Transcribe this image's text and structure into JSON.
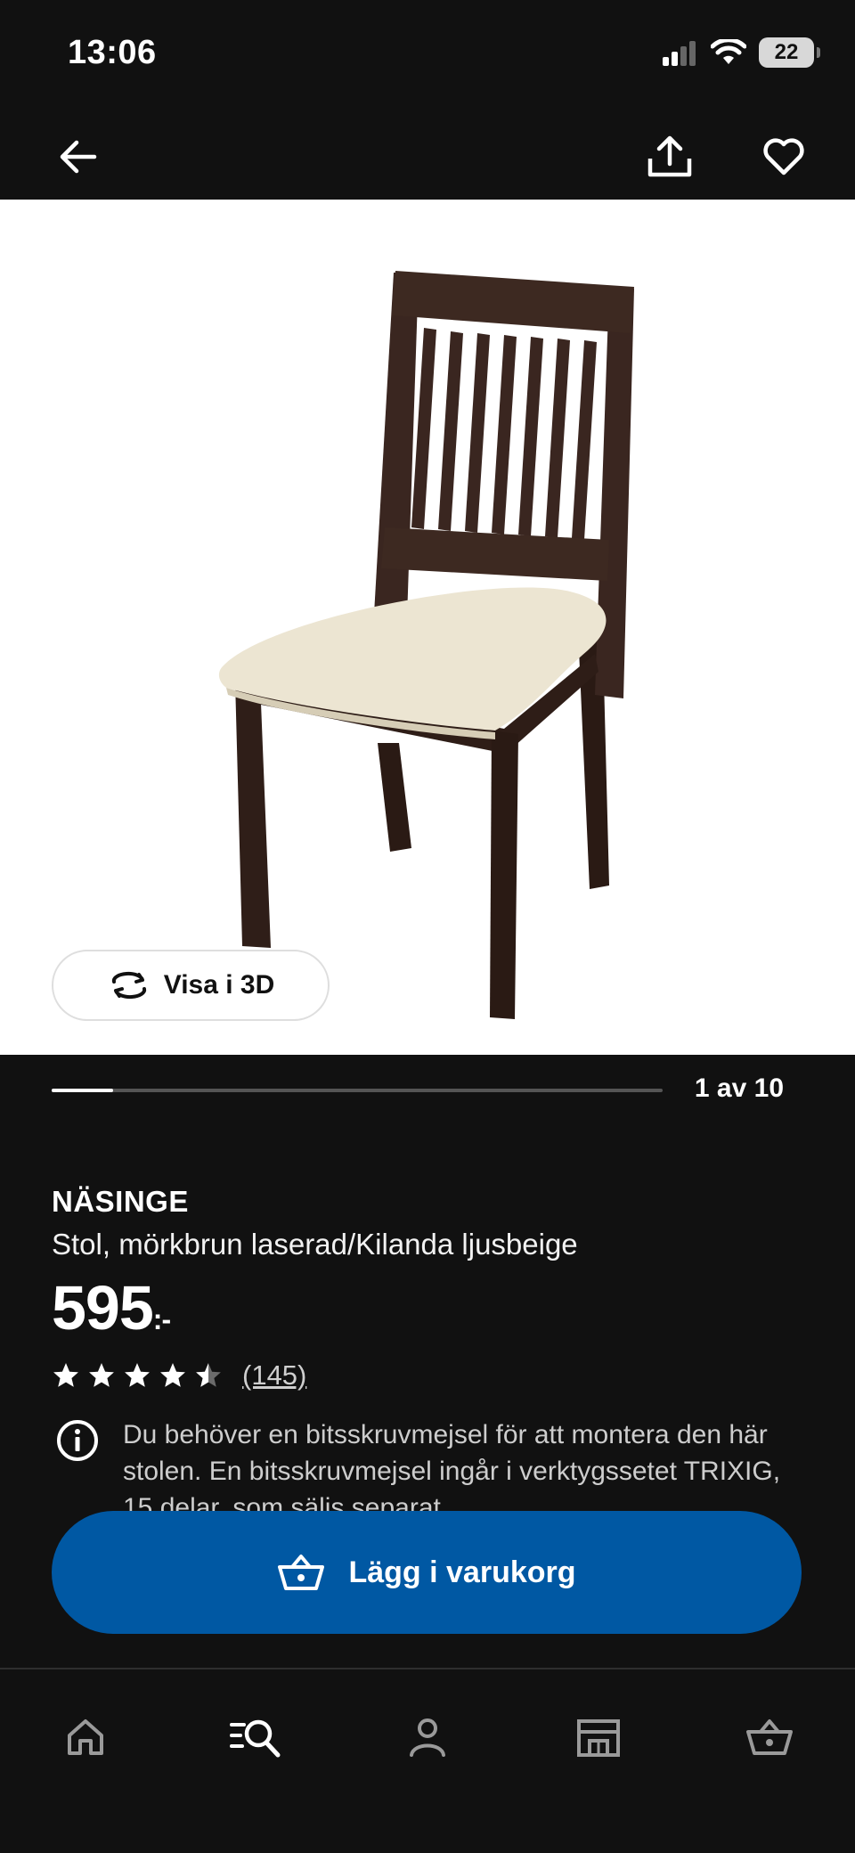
{
  "status_bar": {
    "time": "13:06",
    "battery": "22",
    "icons": [
      "cellular-signal-icon",
      "wifi-icon",
      "battery-icon"
    ]
  },
  "top_nav": {
    "icons": [
      "back-arrow-icon",
      "share-icon",
      "heart-icon"
    ]
  },
  "gallery": {
    "image_alt": "NÄSINGE chair",
    "view_3d_label": "Visa i 3D",
    "page_counter": "1 av 10",
    "progress_fraction": 0.1
  },
  "product": {
    "name": "NÄSINGE",
    "description": "Stol, mörkbrun laserad/Kilanda ljusbeige",
    "price": "595",
    "price_suffix": ":-",
    "rating": 4.5,
    "review_count": "(145)",
    "info_text": "Du behöver en bitsskruvmejsel för att montera den här stolen. En bitsskruvmejsel ingår i verktygssetet TRIXIG, 15 delar, som säljs separat."
  },
  "cart_button": {
    "label": "Lägg i varukorg",
    "color": "#0058a3"
  },
  "tab_bar": {
    "items": [
      "home-icon",
      "search-menu-icon",
      "profile-icon",
      "store-icon",
      "basket-icon"
    ]
  }
}
